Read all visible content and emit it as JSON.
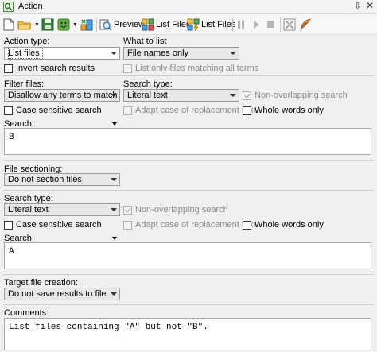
{
  "window": {
    "title": "Action",
    "pin_glyph": "⇩",
    "close_glyph": "✕"
  },
  "toolbar": {
    "preview_label": "Preview",
    "list_files_label_1": "List Files",
    "list_files_label_2": "List Files"
  },
  "action_type": {
    "label": "Action type:",
    "value": "List files"
  },
  "what_to_list": {
    "label": "What to list",
    "value": "File names only"
  },
  "invert_search": {
    "label": "Invert search results"
  },
  "list_only_matching": {
    "label": "List only files matching all terms"
  },
  "filter": {
    "filter_files_label": "Filter files:",
    "filter_files_value": "Disallow any terms to match",
    "search_type_label": "Search type:",
    "search_type_value": "Literal text",
    "non_overlapping": "Non-overlapping search",
    "case_sensitive": "Case sensitive search",
    "adapt_case": "Adapt case of replacement text",
    "whole_words": "Whole words only",
    "search_label": "Search:",
    "search_text": "B"
  },
  "sectioning": {
    "label": "File sectioning:",
    "value": "Do not section files"
  },
  "main_search": {
    "search_type_label": "Search type:",
    "search_type_value": "Literal text",
    "non_overlapping": "Non-overlapping search",
    "case_sensitive": "Case sensitive search",
    "adapt_case": "Adapt case of replacement text",
    "whole_words": "Whole words only",
    "search_label": "Search:",
    "search_text": "A"
  },
  "target": {
    "label": "Target file creation:",
    "value": "Do not save results to file"
  },
  "comments": {
    "label": "Comments:",
    "text": "List files containing \"A\" but not \"B\"."
  }
}
